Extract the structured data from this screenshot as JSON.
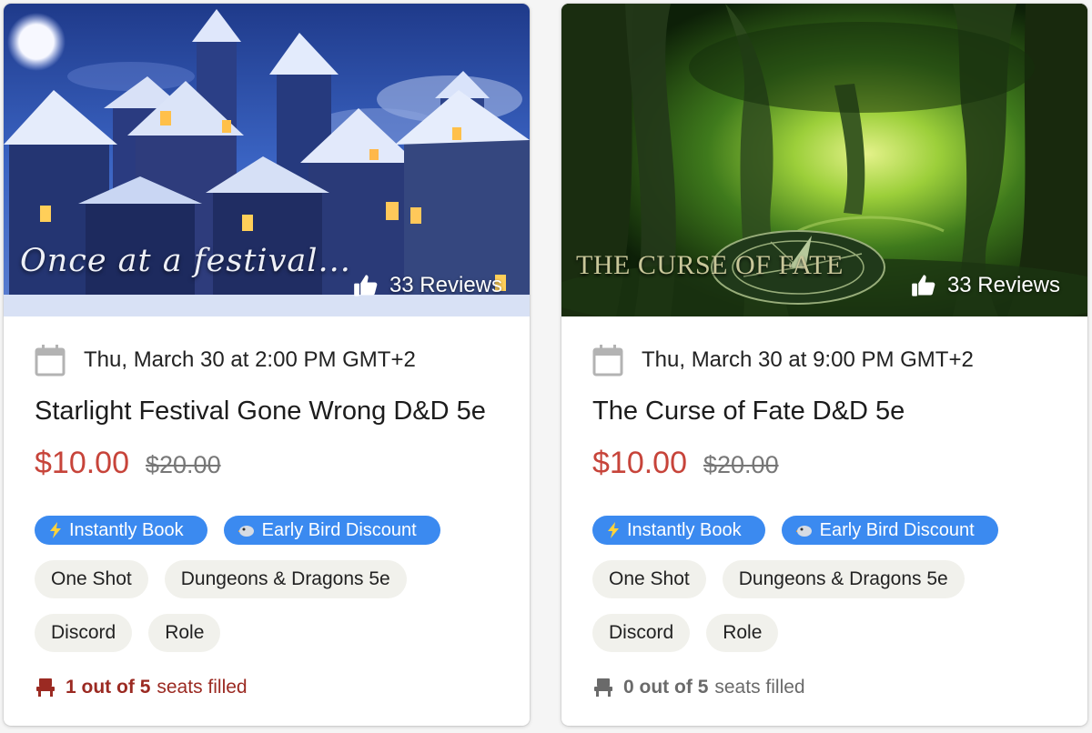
{
  "cards": [
    {
      "hero_title": "Once at a festival...",
      "reviews": "33 Reviews",
      "date": "Thu, March 30 at 2:00 PM GMT+2",
      "title": "Starlight Festival Gone Wrong D&D 5e",
      "price": "$10.00",
      "original_price": "$20.00",
      "badges": [
        "Instantly Book",
        "Early Bird Discount"
      ],
      "tags": [
        "One Shot",
        "Dungeons & Dragons 5e",
        "Discord",
        "Role"
      ],
      "seats": {
        "filled": "1",
        "of": "out of",
        "total": "5",
        "suffix": "seats filled",
        "color": "#9b2a22"
      }
    },
    {
      "hero_title": "THE CURSE OF FATE",
      "reviews": "33 Reviews",
      "date": "Thu, March 30 at 9:00 PM GMT+2",
      "title": "The Curse of Fate D&D 5e",
      "price": "$10.00",
      "original_price": "$20.00",
      "badges": [
        "Instantly Book",
        "Early Bird Discount"
      ],
      "tags": [
        "One Shot",
        "Dungeons & Dragons 5e",
        "Discord",
        "Role"
      ],
      "seats": {
        "filled": "0",
        "of": "out of",
        "total": "5",
        "suffix": "seats filled",
        "color": "#6a6a6a"
      }
    }
  ],
  "colors": {
    "price": "#c7443a",
    "badge": "#3b8af0",
    "tag": "#f1f1ec"
  },
  "icons": {
    "date": "calendar-icon",
    "reviews": "thumbs-up-icon",
    "instant": "lightning-icon",
    "early_bird": "bird-icon",
    "seats": "seat-icon"
  }
}
